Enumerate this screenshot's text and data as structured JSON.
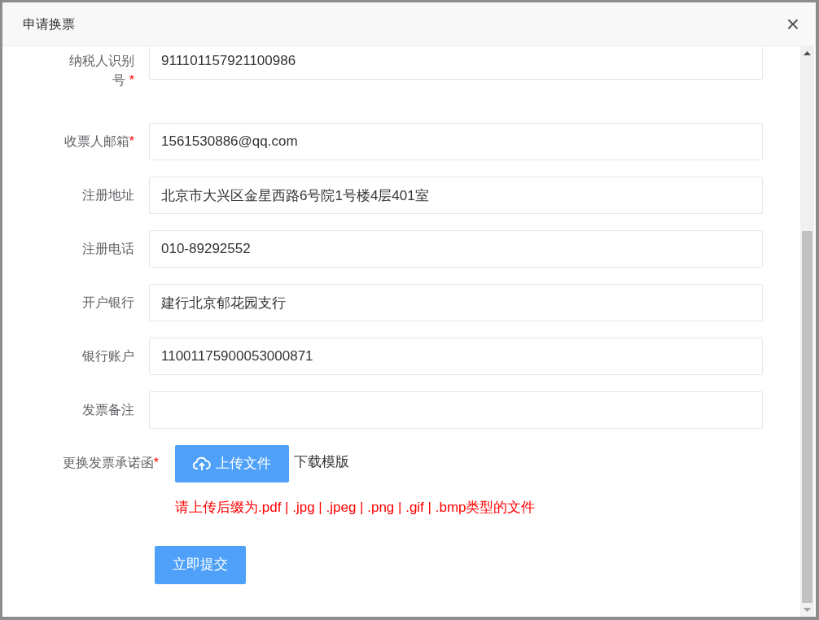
{
  "dialog": {
    "title": "申请换票",
    "close": "×"
  },
  "fields": [
    {
      "label": "纳税人识别号",
      "required_mark": "*",
      "value": "911101157921100986"
    },
    {
      "label": "收票人邮箱",
      "required_mark": "*",
      "value": "1561530886@qq.com"
    },
    {
      "label": "注册地址",
      "value": "北京市大兴区金星西路6号院1号楼4层401室"
    },
    {
      "label": "注册电话",
      "value": "010-89292552"
    },
    {
      "label": "开户银行",
      "value": "建行北京郁花园支行"
    },
    {
      "label": "银行账户",
      "value": "11001175900053000871"
    },
    {
      "label": "发票备注"
    }
  ],
  "upload": {
    "label": "更换发票承诺函",
    "required_mark": "*",
    "button": "上传文件",
    "link": "下载模版",
    "hint": "请上传后缀为.pdf | .jpg | .jpeg | .png | .gif | .bmp类型的文件"
  },
  "submit": "立即提交"
}
